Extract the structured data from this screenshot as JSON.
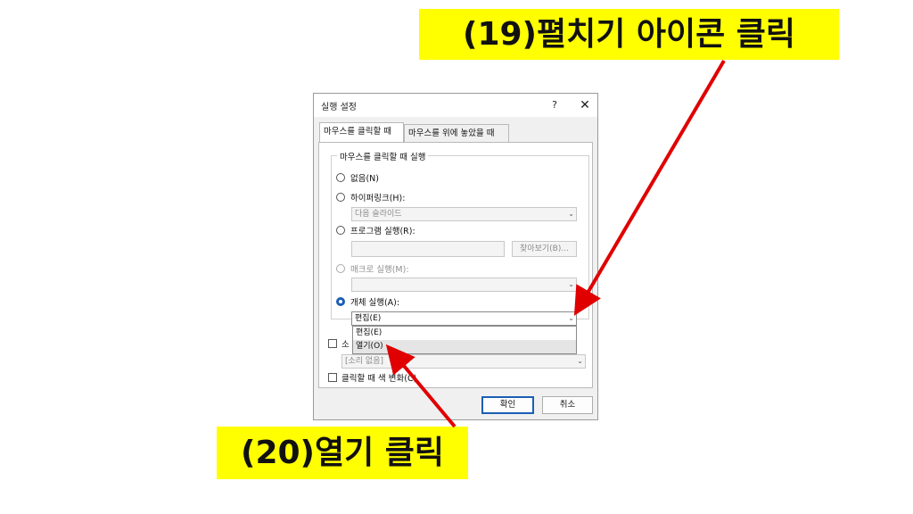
{
  "dialog": {
    "title": "실행 설정",
    "help_label": "?",
    "close_label": "✕",
    "tabs": [
      {
        "label": "마우스를 클릭할 때"
      },
      {
        "label": "마우스를 위에 놓았을 때"
      }
    ],
    "group_label": "마우스를 클릭할 때 실행",
    "options": {
      "none": "없음(N)",
      "hyperlink": "하이퍼링크(H):",
      "hyperlink_value": "다음 슬라이드",
      "program": "프로그램 실행(R):",
      "browse_label": "찾아보기(B)...",
      "macro": "매크로 실행(M):",
      "object": "개체 실행(A):",
      "object_value": "편집(E)"
    },
    "dropdown_items": [
      "편집(E)",
      "열기(O)"
    ],
    "sound_label": "소",
    "sound_value": "[소리 없음]",
    "highlight_label": "클릭할 때 색 변화(C)",
    "ok_label": "확인",
    "cancel_label": "취소"
  },
  "callouts": {
    "top": "(19)펼치기 아이콘 클릭",
    "bottom": "(20)열기 클릭"
  },
  "colors": {
    "callout_bg": "#ffff00",
    "arrow": "#e00000",
    "accent": "#1a5fb4"
  }
}
